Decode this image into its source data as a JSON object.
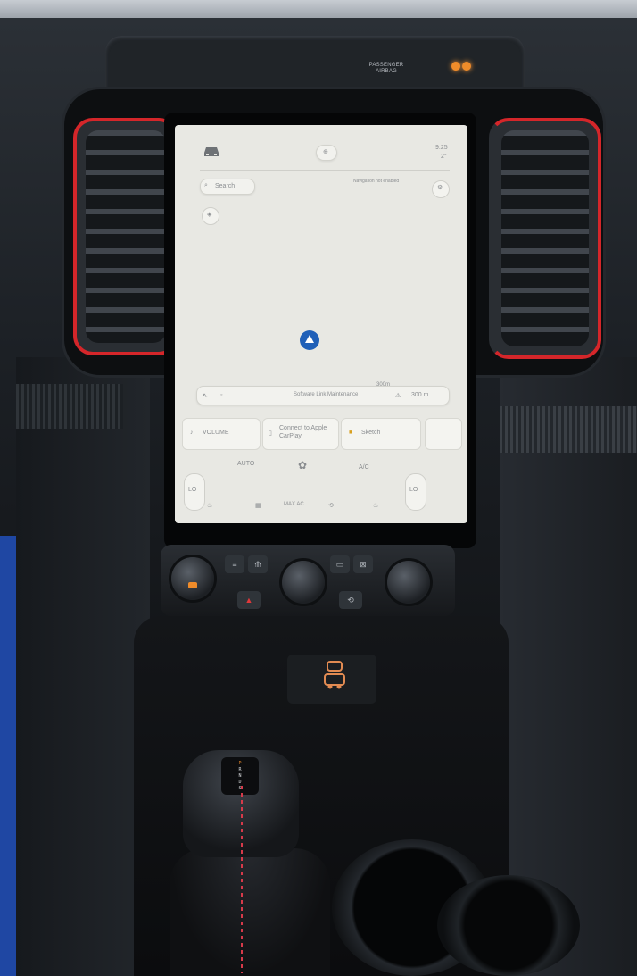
{
  "photo": {
    "subject": "vehicle center console with portrait touchscreen",
    "accent_colors": {
      "vent_trim": "#d4262a",
      "side_panel": "#1f47a3",
      "indicator": "#f08c2a"
    }
  },
  "dashboard": {
    "airbag_label_line1": "PASSENGER",
    "airbag_label_line2": "AIRBAG"
  },
  "screen": {
    "status_bar": {
      "car_icon": "car-icon",
      "center_pill": "⊕",
      "time": "9:25",
      "temp": "2°"
    },
    "map": {
      "search_label": "Search",
      "top_right_note": "Navigation not enabled",
      "scale_label": "300m",
      "compass_icon": "compass-icon",
      "bottom_status": "Software Link Maintenance",
      "distance": "300 m"
    },
    "cards": [
      {
        "label": "VOLUME",
        "icon": "volume-icon"
      },
      {
        "label": "Connect to Apple CarPlay",
        "icon": "phone-icon"
      },
      {
        "label": "Sketch",
        "icon": "sketch-icon"
      }
    ],
    "climate_row": {
      "left_label": "AUTO",
      "fan_label": "fan",
      "right_label": "A/C",
      "left_side": "LO",
      "right_side": "LO"
    },
    "bottom_row": [
      "seat",
      "rear",
      "MAX AC",
      "recirc",
      "heat"
    ]
  },
  "climate_panel": {
    "left_knob": "left-temperature-knob",
    "center_knob": "fan-knob",
    "right_knob": "right-temperature-knob",
    "keys": [
      "≡",
      "⟰",
      "▭",
      "⊠"
    ],
    "hazard": "▲",
    "recirc": "⟲"
  },
  "shifter": {
    "gears": [
      "P",
      "R",
      "N",
      "D",
      "S"
    ]
  }
}
